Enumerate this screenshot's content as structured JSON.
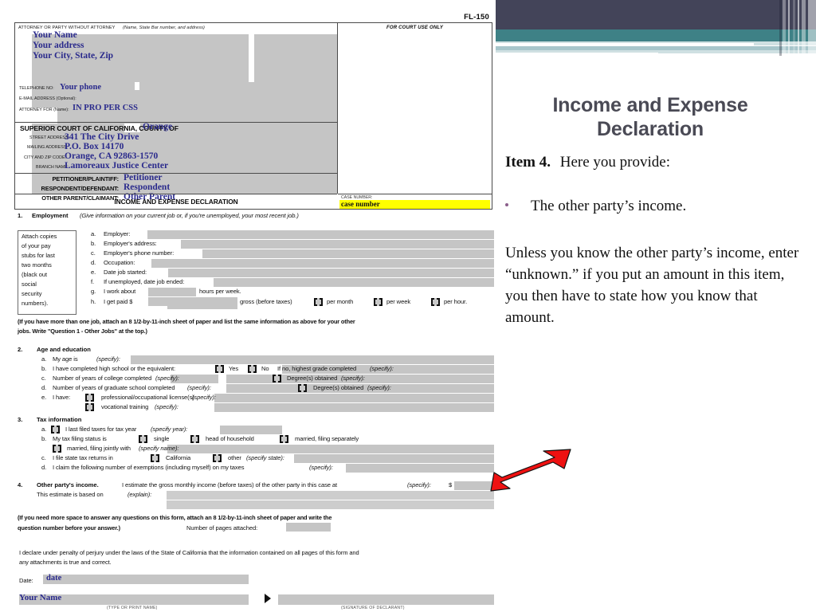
{
  "slide": {
    "title_line1": "Income and Expense",
    "title_line2": "Declaration",
    "item_label": "Item 4.",
    "item_text": "Here you provide:",
    "bullet": "The other party’s income.",
    "paragraph": "Unless you know the other party’s income, enter “unknown.”  if you put an amount in this item, you then have to state how you know that amount.",
    "accent_purple": "#8b5f8b",
    "banner_navy": "#434459",
    "banner_teal": "#3e8186",
    "arrow_color": "#ee1111"
  },
  "form": {
    "form_number": "FL-150",
    "header": {
      "attorney_caption": "ATTORNEY OR PARTY WITHOUT ATTORNEY",
      "attorney_caption_italic": "(Name, State Bar number, and address)",
      "name": "Your Name",
      "address": "Your address",
      "city_state_zip": "Your City, State, Zip",
      "telephone_label": "TELEPHONE NO:",
      "telephone_value": "Your phone",
      "email_label": "E-MAIL ADDRESS (Optional):",
      "attorney_for_label": "ATTORNEY FOR  (Name):",
      "attorney_for_value": "IN PRO PER    CSS",
      "court_line": "SUPERIOR COURT OF CALIFORNIA, COUNTY OF",
      "county": "Orange",
      "street_label": "STREET ADDRESS:",
      "street_value": "341 The City Drive",
      "mailing_label": "MAILING ADDRESS:",
      "mailing_value": "P.O. Box 14170",
      "citzip_label": "CITY AND ZIP CODE:",
      "citzip_value": "Orange, CA 92863-1570",
      "branch_label": "BRANCH NAME:",
      "branch_value": "Lamoreaux Justice Center",
      "petitioner_label": "PETITIONER/PLAINTIFF:",
      "petitioner_value": "Petitioner",
      "respondent_label": "RESPONDENT/DEFENDANT:",
      "respondent_value": "Respondent",
      "otherparent_label": "OTHER PARENT/CLAIMANT:",
      "otherparent_value": "Other Parent",
      "form_title": "INCOME AND EXPENSE DECLARATION",
      "court_use_only": "FOR COURT USE ONLY",
      "case_number_label": "CASE NUMBER:",
      "case_number_value": "case number"
    },
    "section1": {
      "num": "1.",
      "title": "Employment",
      "subtitle": "(Give information on your current job or, if you're unemployed, your most recent job.)",
      "attach_note": [
        "Attach copies",
        "of your pay",
        "stubs for last",
        "two months",
        "(black out",
        "social",
        "security",
        "numbers)."
      ],
      "rows": [
        {
          "letter": "a.",
          "text": "Employer:"
        },
        {
          "letter": "b.",
          "text": "Employer's address:"
        },
        {
          "letter": "c.",
          "text": "Employer's phone number:"
        },
        {
          "letter": "d.",
          "text": "Occupation:"
        },
        {
          "letter": "e.",
          "text": "Date job started:"
        },
        {
          "letter": "f.",
          "text": "If unemployed, date job ended:"
        }
      ],
      "row_g_letter": "g.",
      "row_g_pre": "I work about",
      "row_g_post": "hours per week.",
      "row_h_letter": "h.",
      "row_h_pre": "I get paid $",
      "row_h_gross": "gross (before taxes)",
      "row_h_opt1": "per month",
      "row_h_opt2": "per week",
      "row_h_opt3": "per hour.",
      "footnote_line1": "(If you have more than one job, attach an 8 1/2-by-11-inch sheet of paper and list the same information as above for your other",
      "footnote_line2": "jobs. Write \"Question 1 - Other Jobs\" at the top.)"
    },
    "section2": {
      "num": "2.",
      "title": "Age and education",
      "a_letter": "a.",
      "a_text": "My age is",
      "a_italic": "(specify):",
      "b_letter": "b.",
      "b_text": "I have completed high school or the equivalent:",
      "b_yes": "Yes",
      "b_no": "No",
      "b_tail": "If no, highest grade completed",
      "b_tail_italic": "(specify):",
      "c_letter": "c.",
      "c_text": "Number of years of college completed",
      "c_italic": "(specify):",
      "c_degree": "Degree(s) obtained",
      "c_degree_italic": "(specify):",
      "d_letter": "d.",
      "d_text": "Number of years of graduate school completed",
      "d_italic": "(specify):",
      "d_degree": "Degree(s) obtained",
      "d_degree_italic": "(specify):",
      "e_letter": "e.",
      "e_text": "I have:",
      "e_opt1": "professional/occupational license(s)",
      "e_opt1_italic": "(specify):",
      "e_opt2": "vocational training",
      "e_opt2_italic": "(specify):"
    },
    "section3": {
      "num": "3.",
      "title": "Tax information",
      "a_letter": "a.",
      "a_text": "I last filed taxes for tax year",
      "a_italic": "(specify year):",
      "b_letter": "b.",
      "b_text": "My tax filing status is",
      "b_opt1": "single",
      "b_opt2": "head of household",
      "b_opt3": "married, filing separately",
      "b_opt4": "married, filing jointly with",
      "b_opt4_italic": "(specify name):",
      "c_letter": "c.",
      "c_text": "I file state tax returns in",
      "c_opt1": "California",
      "c_opt2": "other",
      "c_opt2_italic": "(specify state):",
      "d_letter": "d.",
      "d_text": "I claim the following number of exemptions (including myself) on my taxes",
      "d_italic": "(specify):"
    },
    "section4": {
      "num": "4.",
      "title": "Other party's income.",
      "text": "I estimate the gross monthly income (before taxes) of the other party in this case at",
      "italic": "(specify):",
      "dollar": "$",
      "line2": "This estimate is based on",
      "line2_italic": "(explain):"
    },
    "more_space": {
      "line1": "(If you need more space to answer any questions on this form, attach an 8 1/2-by-11-inch sheet of paper and write the",
      "line2": "question number before your answer.)",
      "pages_label": "Number of pages attached:"
    },
    "declaration": {
      "line1": "I declare under penalty of perjury under the laws of the State of California that the information contained on all pages of this form and",
      "line2": "any attachments is true and correct.",
      "date_label": "Date:",
      "date_value": "date",
      "signer_name": "Your Name",
      "type_print_caption": "(TYPE OR PRINT NAME)",
      "signature_caption": "(SIGNATURE OF DECLARANT)"
    }
  }
}
